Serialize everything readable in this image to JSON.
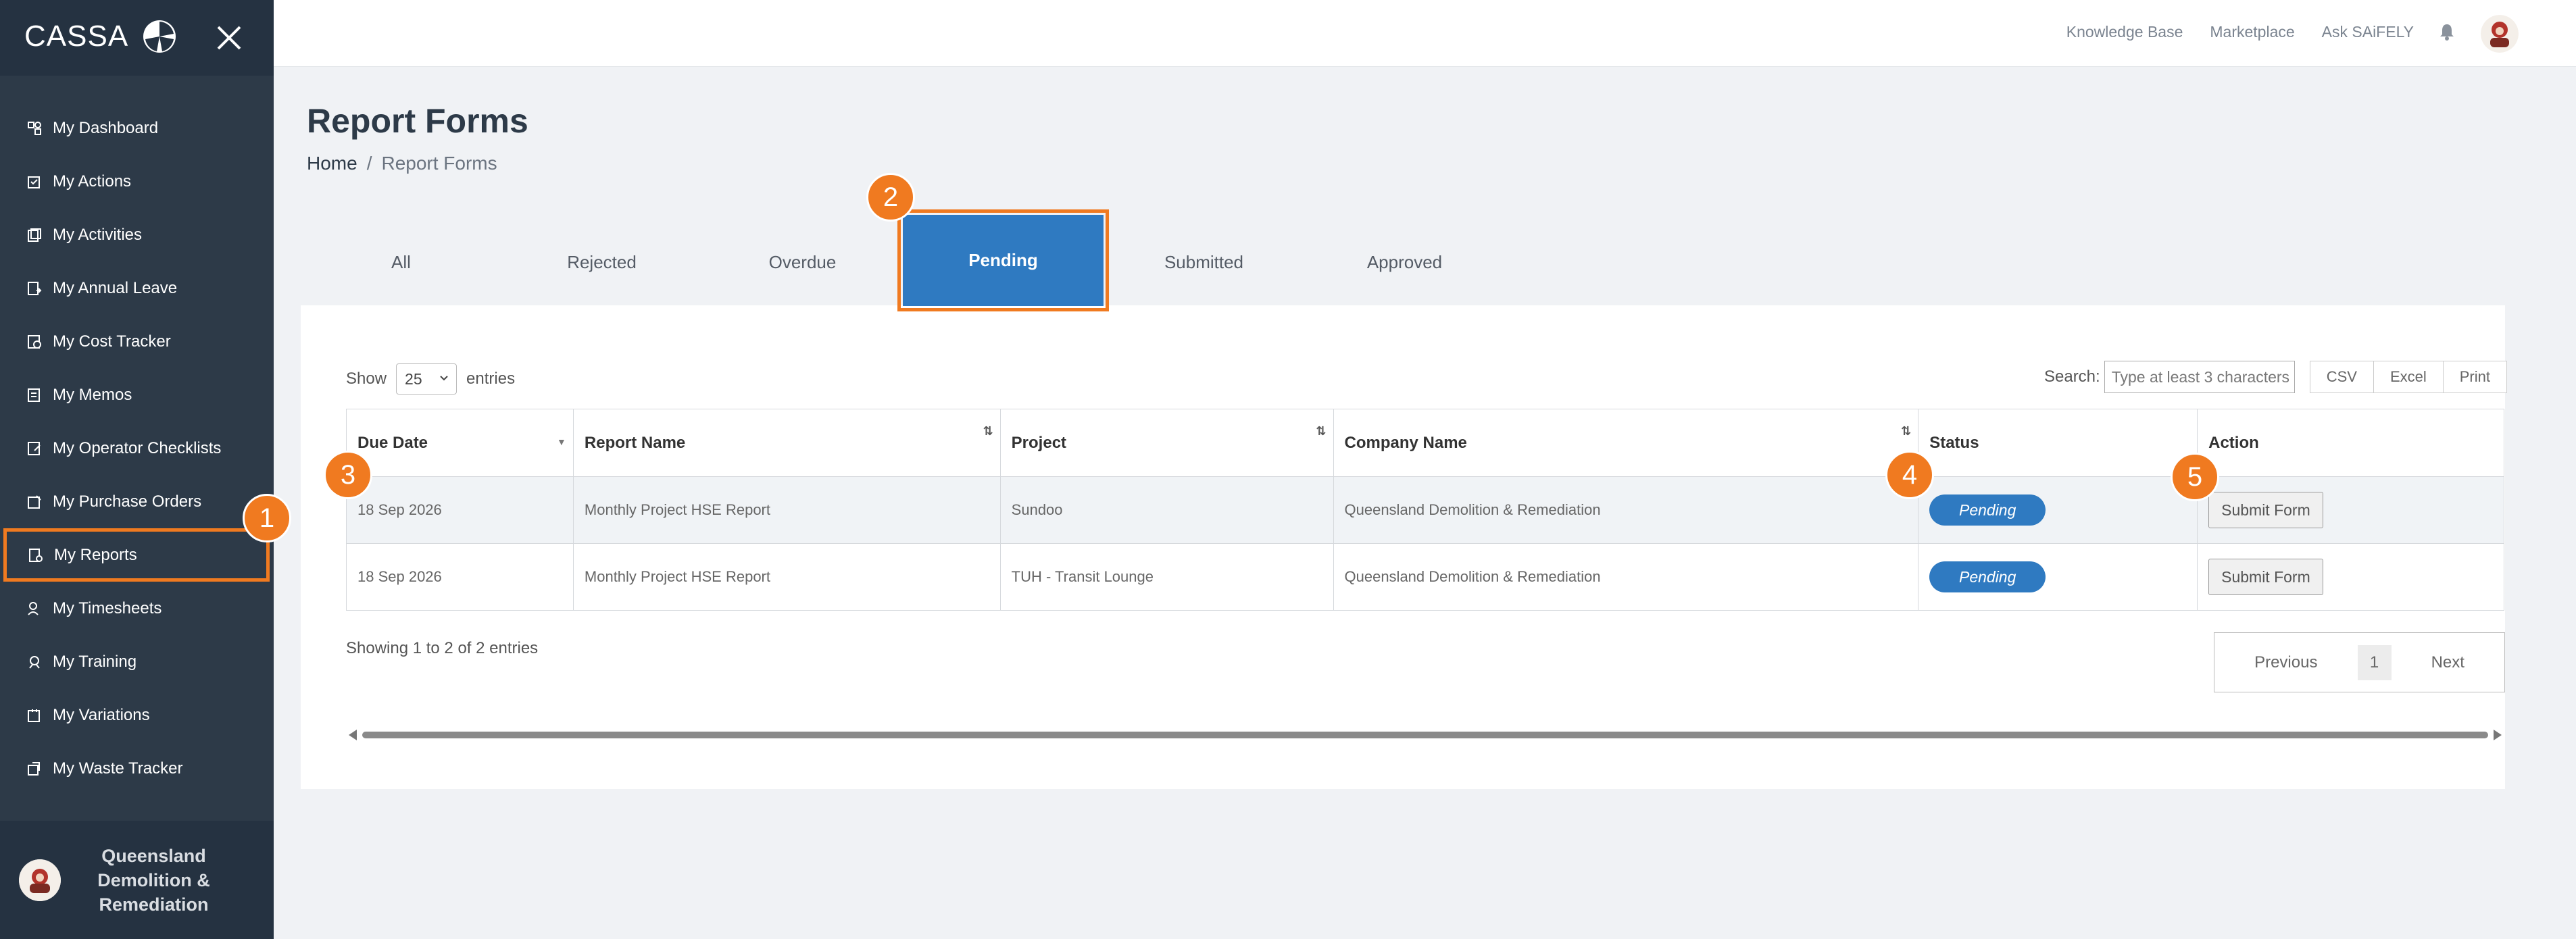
{
  "app": {
    "logo_text": "CASSA"
  },
  "sidebar": {
    "items": [
      {
        "label": "My Dashboard",
        "icon": "dashboard-icon"
      },
      {
        "label": "My Actions",
        "icon": "actions-icon"
      },
      {
        "label": "My Activities",
        "icon": "activities-icon"
      },
      {
        "label": "My Annual Leave",
        "icon": "leave-icon"
      },
      {
        "label": "My Cost Tracker",
        "icon": "cost-icon"
      },
      {
        "label": "My Memos",
        "icon": "memos-icon"
      },
      {
        "label": "My Operator Checklists",
        "icon": "checklist-icon"
      },
      {
        "label": "My Purchase Orders",
        "icon": "purchase-icon"
      },
      {
        "label": "My Reports",
        "icon": "reports-icon"
      },
      {
        "label": "My Timesheets",
        "icon": "timesheets-icon"
      },
      {
        "label": "My Training",
        "icon": "training-icon"
      },
      {
        "label": "My Variations",
        "icon": "variations-icon"
      },
      {
        "label": "My Waste Tracker",
        "icon": "waste-icon"
      }
    ],
    "active_index": 8,
    "company": "Queensland Demolition & Remediation"
  },
  "topbar": {
    "links": [
      "Knowledge Base",
      "Marketplace",
      "Ask SAiFELY"
    ]
  },
  "page": {
    "title": "Report Forms",
    "breadcrumb": {
      "home": "Home",
      "separator": "/",
      "current": "Report Forms"
    }
  },
  "tabs": [
    "All",
    "Rejected",
    "Overdue",
    "Pending",
    "Submitted",
    "Approved"
  ],
  "active_tab": "Pending",
  "table_controls": {
    "show_label": "Show",
    "entries_value": "25",
    "entries_label": "entries",
    "search_label": "Search:",
    "search_placeholder": "Type at least 3 characters",
    "export_buttons": [
      "CSV",
      "Excel",
      "Print"
    ]
  },
  "table": {
    "columns": [
      "Due Date",
      "Report Name",
      "Project",
      "Company Name",
      "Status",
      "Action"
    ],
    "rows": [
      {
        "due_date": "18 Sep 2026",
        "report_name": "Monthly Project HSE Report",
        "project": "Sundoo",
        "company": "Queensland Demolition & Remediation",
        "status": "Pending",
        "action": "Submit Form"
      },
      {
        "due_date": "18 Sep 2026",
        "report_name": "Monthly Project HSE Report",
        "project": "TUH - Transit Lounge",
        "company": "Queensland Demolition & Remediation",
        "status": "Pending",
        "action": "Submit Form"
      }
    ]
  },
  "footer": {
    "info": "Showing 1 to 2 of 2 entries",
    "previous": "Previous",
    "page": "1",
    "next": "Next"
  },
  "markers": [
    "1",
    "2",
    "3",
    "4",
    "5"
  ],
  "colors": {
    "accent": "#2f7ac1",
    "highlight": "#f07a20",
    "sidebar": "#2d3a48"
  }
}
